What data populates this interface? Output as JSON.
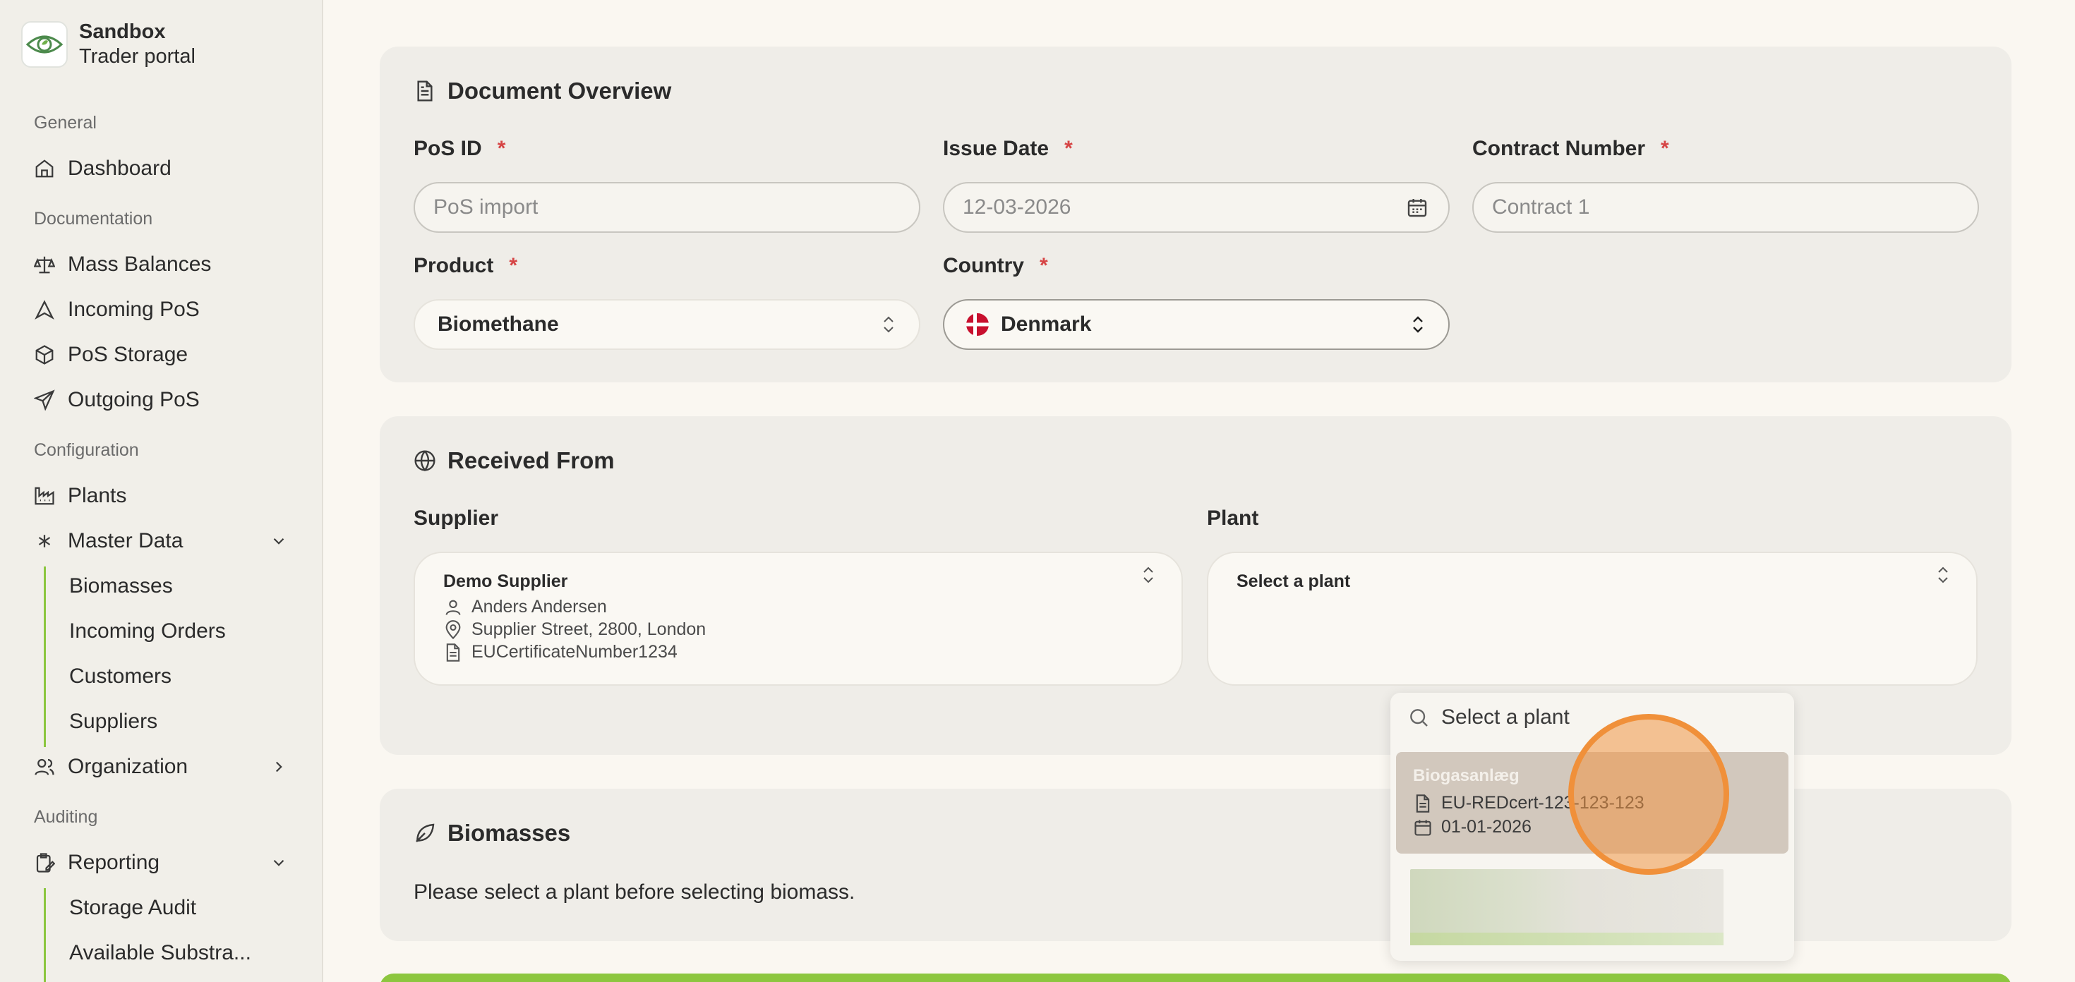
{
  "brand": {
    "title": "Sandbox",
    "subtitle": "Trader portal",
    "logo_icon": "eye-leaf-logo"
  },
  "colors": {
    "accent_green": "#8cc63f",
    "required": "#d64545",
    "cursor": "#f0903a"
  },
  "sidebar": {
    "sections": {
      "general": "General",
      "documentation": "Documentation",
      "configuration": "Configuration",
      "auditing": "Auditing"
    },
    "items": {
      "dashboard": "Dashboard",
      "mass_balances": "Mass Balances",
      "incoming_pos": "Incoming PoS",
      "pos_storage": "PoS Storage",
      "outgoing_pos": "Outgoing PoS",
      "plants": "Plants",
      "master_data": "Master Data",
      "organization": "Organization",
      "reporting": "Reporting"
    },
    "master_data_sub": [
      "Biomasses",
      "Incoming Orders",
      "Customers",
      "Suppliers"
    ],
    "reporting_sub": [
      "Storage Audit",
      "Available Substra..."
    ]
  },
  "document_overview": {
    "title": "Document Overview",
    "pos_id": {
      "label": "PoS ID",
      "placeholder": "PoS import"
    },
    "issue_date": {
      "label": "Issue Date",
      "value": "12-03-2026"
    },
    "contract_number": {
      "label": "Contract Number",
      "placeholder": "Contract 1"
    },
    "product": {
      "label": "Product",
      "value": "Biomethane"
    },
    "country": {
      "label": "Country",
      "value": "Denmark"
    },
    "required_mark": "*"
  },
  "received_from": {
    "title": "Received From",
    "supplier": {
      "label": "Supplier",
      "name": "Demo Supplier",
      "contact": "Anders Andersen",
      "address": "Supplier Street, 2800, London",
      "certificate": "EUCertificateNumber1234"
    },
    "plant": {
      "label": "Plant",
      "placeholder": "Select a plant"
    }
  },
  "plant_dropdown": {
    "search_placeholder": "Select a plant",
    "options": [
      {
        "name": "Biogasanlæg",
        "certificate": "EU-REDcert-123-123-123",
        "date": "01-01-2026"
      }
    ]
  },
  "biomasses": {
    "title": "Biomasses",
    "message": "Please select a plant before selecting biomass."
  }
}
